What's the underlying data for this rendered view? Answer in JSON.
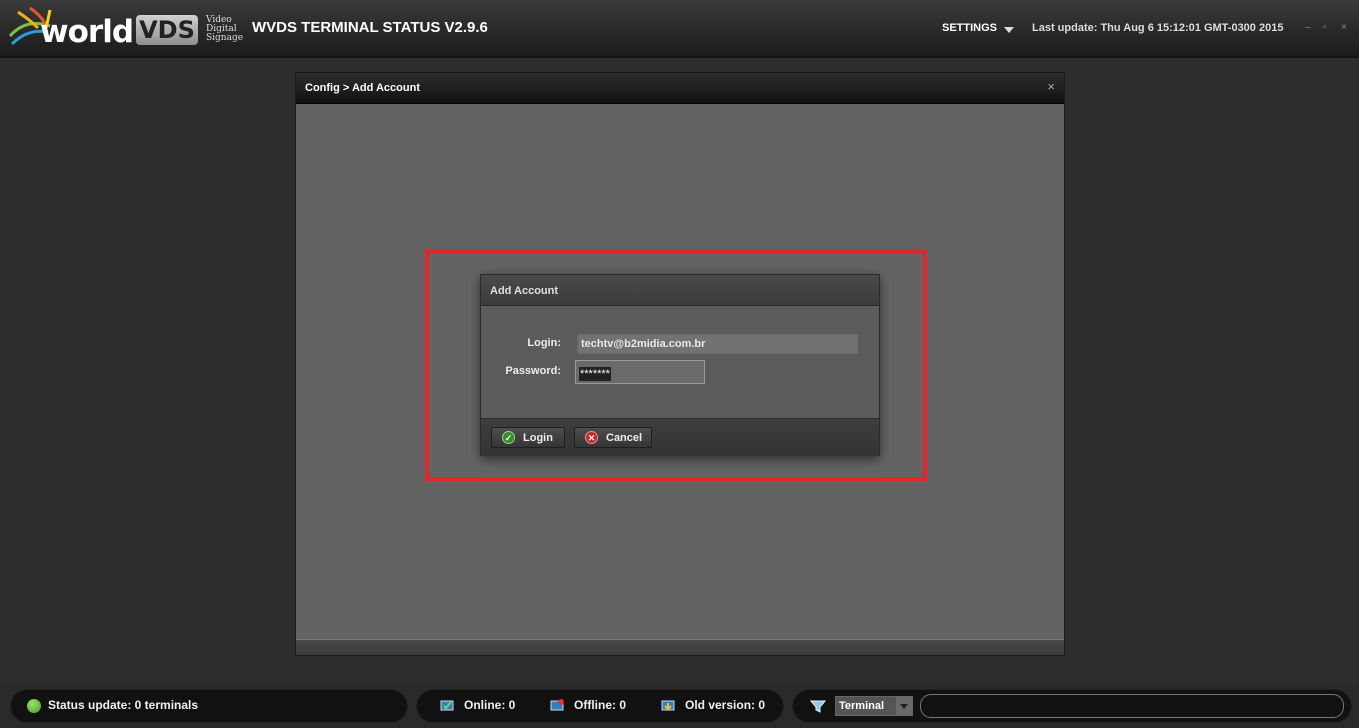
{
  "header": {
    "logo": {
      "world": "world",
      "vds": "VDS",
      "tagline": [
        "Video",
        "Digital",
        "Signage"
      ]
    },
    "title": "WVDS TERMINAL STATUS V2.9.6",
    "settings_label": "SETTINGS",
    "last_update": "Last update: Thu Aug 6 15:12:01 GMT-0300 2015",
    "window_controls": [
      "–",
      "▫",
      "×"
    ]
  },
  "config_window": {
    "title": "Config > Add Account",
    "close": "×"
  },
  "dialog": {
    "title": "Add Account",
    "login_label": "Login:",
    "login_value": "techtv@b2midia.com.br",
    "password_label": "Password:",
    "password_value": "*******",
    "login_button": "Login",
    "cancel_button": "Cancel"
  },
  "statusbar": {
    "status_update": "Status update: 0 terminals",
    "online": "Online: 0",
    "offline": "Offline: 0",
    "old_version": "Old version: 0",
    "filter_select": "Terminal",
    "search_value": ""
  },
  "colors": {
    "highlight": "#e3262b",
    "status_green": "#4caf22",
    "ok_green": "#3b8a2a",
    "cancel_red": "#c0282b"
  }
}
